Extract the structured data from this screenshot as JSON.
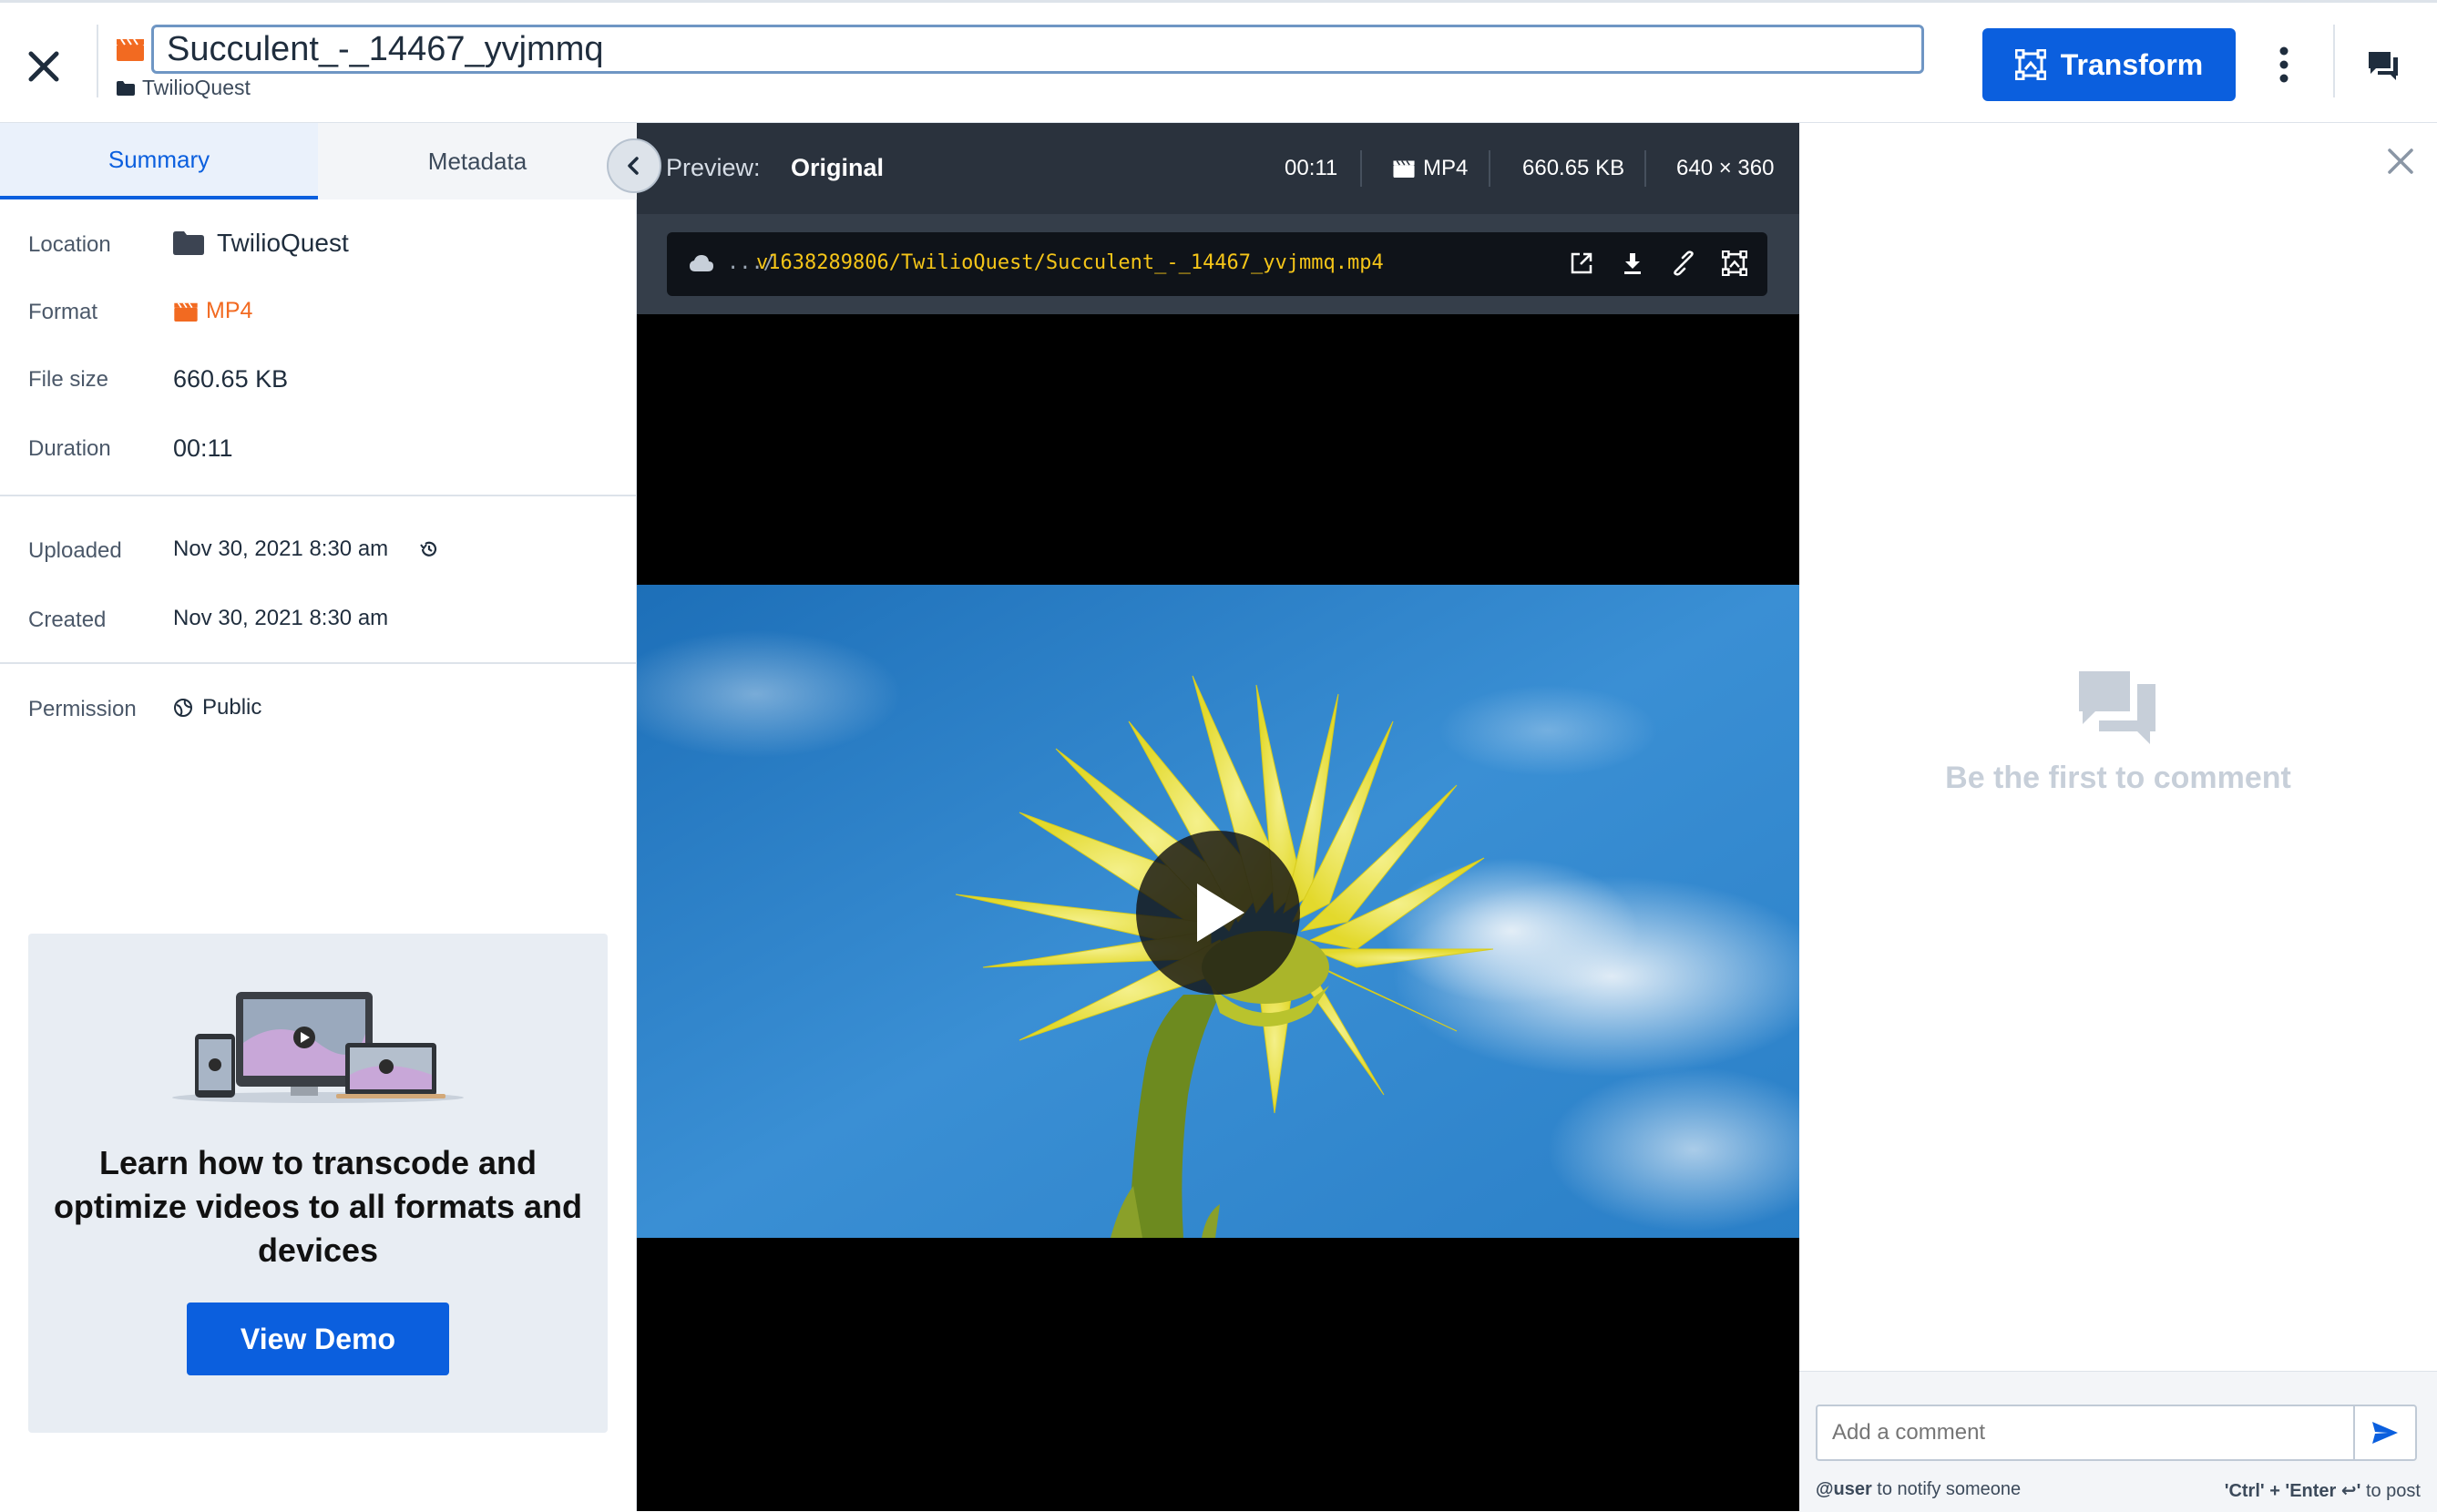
{
  "header": {
    "asset_name": "Succulent_-_14467_yvjmmq",
    "folder": "TwilioQuest",
    "transform_label": "Transform"
  },
  "tabs": [
    {
      "label": "Summary",
      "active": true
    },
    {
      "label": "Metadata",
      "active": false
    }
  ],
  "summary": {
    "location_label": "Location",
    "location_value": "TwilioQuest",
    "format_label": "Format",
    "format_value": "MP4",
    "filesize_label": "File size",
    "filesize_value": "660.65 KB",
    "duration_label": "Duration",
    "duration_value": "00:11",
    "uploaded_label": "Uploaded",
    "uploaded_value": "Nov 30, 2021 8:30 am",
    "created_label": "Created",
    "created_value": "Nov 30, 2021 8:30 am",
    "permission_label": "Permission",
    "permission_value": "Public"
  },
  "promo": {
    "text": "Learn how to transcode and optimize videos to all formats and devices",
    "button_label": "View Demo"
  },
  "preview": {
    "label": "Preview:",
    "mode": "Original",
    "duration": "00:11",
    "format": "MP4",
    "size": "660.65 KB",
    "dimensions": "640 × 360",
    "url_prefix": ".../",
    "url_path": "v1638289806/TwilioQuest/Succulent_-_14467_yvjmmq.mp4"
  },
  "comments": {
    "empty_text": "Be the first to comment",
    "input_placeholder": "Add a comment",
    "hint_mention_strong": "@user",
    "hint_mention_rest": " to notify someone",
    "hint_post_strong": "'Ctrl' + 'Enter ↩'",
    "hint_post_rest": " to post"
  },
  "colors": {
    "accent": "#0b5fde",
    "format_orange": "#f26a21",
    "url_yellow": "#f5c518",
    "preview_header": "#2a323d"
  }
}
